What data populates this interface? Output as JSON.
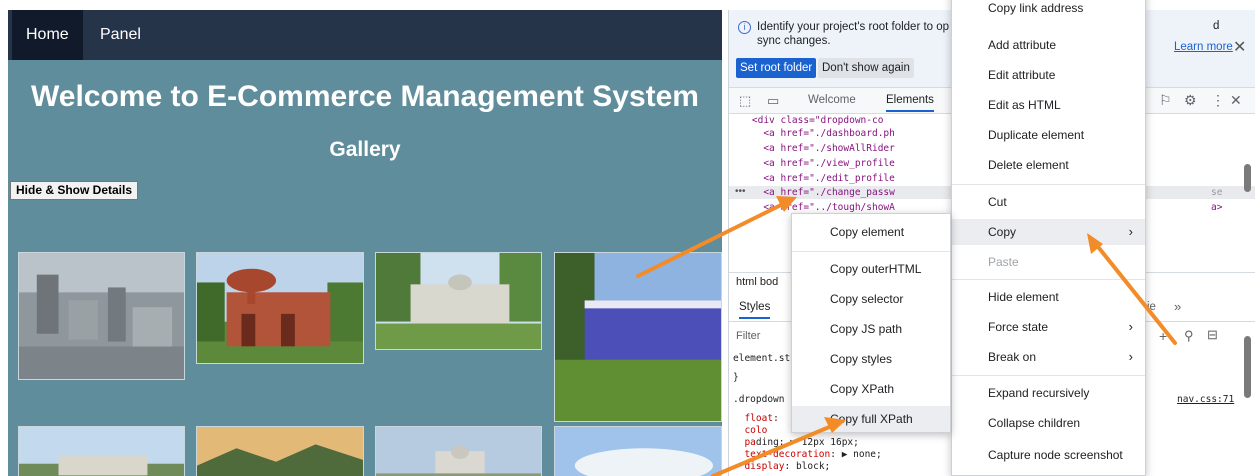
{
  "site": {
    "nav": {
      "home": "Home",
      "panel": "Panel"
    },
    "title": "Welcome to E-Commerce Management System",
    "gallery_title": "Gallery",
    "toggle_button": "Hide & Show Details"
  },
  "devtools": {
    "info_text": "Identify your project's root folder to op sync changes.",
    "info_text_tail": "d",
    "learn_more": "Learn more",
    "set_root": "Set root folder",
    "dont_show": "Don't show again",
    "tabs": {
      "welcome": "Welcome",
      "elements": "Elements"
    },
    "code_lines": [
      "      <a href=\"./dashboard.ph",
      "      <a href=\"./showAllRider",
      "      <a href=\"./view_profile",
      "      <a href=\"./edit_profile",
      "      <a href=\"./change_passw",
      "      <a href=\"../tough/showA"
    ],
    "code_head": "    <div class=\"dropdown-co",
    "code_tail_1": "se",
    "code_tail_2": "a>",
    "dots": "•••",
    "crumbs": "html  bod",
    "styles_tab": "Styles",
    "filter": "Filter",
    "element_style": "element.st",
    "brace": "}",
    "selector": ".dropdown",
    "css_lines": [
      {
        "prop": "float",
        "value": ":"
      },
      {
        "prop": "colo",
        "value": ""
      },
      {
        "prop": "pa",
        "value": "ding: ▶ 12px 16px;"
      },
      {
        "prop": "text-decoration",
        "value": ": ▶ none;"
      },
      {
        "prop": "display",
        "value": ": block;"
      }
    ],
    "css_source": "nav.css:71",
    "right_tail": "ie"
  },
  "context_menu": {
    "items": [
      {
        "label": "Copy link address",
        "disabled": false,
        "submenu": false
      },
      {
        "label": "Add attribute",
        "disabled": false,
        "submenu": false
      },
      {
        "label": "Edit attribute",
        "disabled": false,
        "submenu": false
      },
      {
        "label": "Edit as HTML",
        "disabled": false,
        "submenu": false
      },
      {
        "label": "Duplicate element",
        "disabled": false,
        "submenu": false
      },
      {
        "label": "Delete element",
        "disabled": false,
        "submenu": false
      },
      {
        "label": "Cut",
        "disabled": false,
        "submenu": false
      },
      {
        "label": "Copy",
        "disabled": false,
        "submenu": true,
        "highlighted": true
      },
      {
        "label": "Paste",
        "disabled": true,
        "submenu": false
      },
      {
        "label": "Hide element",
        "disabled": false,
        "submenu": false
      },
      {
        "label": "Force state",
        "disabled": false,
        "submenu": true
      },
      {
        "label": "Break on",
        "disabled": false,
        "submenu": true
      },
      {
        "label": "Expand recursively",
        "disabled": false,
        "submenu": false
      },
      {
        "label": "Collapse children",
        "disabled": false,
        "submenu": false
      },
      {
        "label": "Capture node screenshot",
        "disabled": false,
        "submenu": false
      }
    ],
    "arrow_glyph": "›"
  },
  "copy_submenu": {
    "items": [
      {
        "label": "Copy element"
      },
      {
        "label": "Copy outerHTML"
      },
      {
        "label": "Copy selector"
      },
      {
        "label": "Copy JS path"
      },
      {
        "label": "Copy styles"
      },
      {
        "label": "Copy XPath"
      },
      {
        "label": "Copy full XPath",
        "highlighted": true
      }
    ]
  },
  "colors": {
    "arrow": "#f28c28",
    "nav_bg": "#253449",
    "page_bg": "#5f8d9c",
    "accent": "#1a62d0"
  }
}
